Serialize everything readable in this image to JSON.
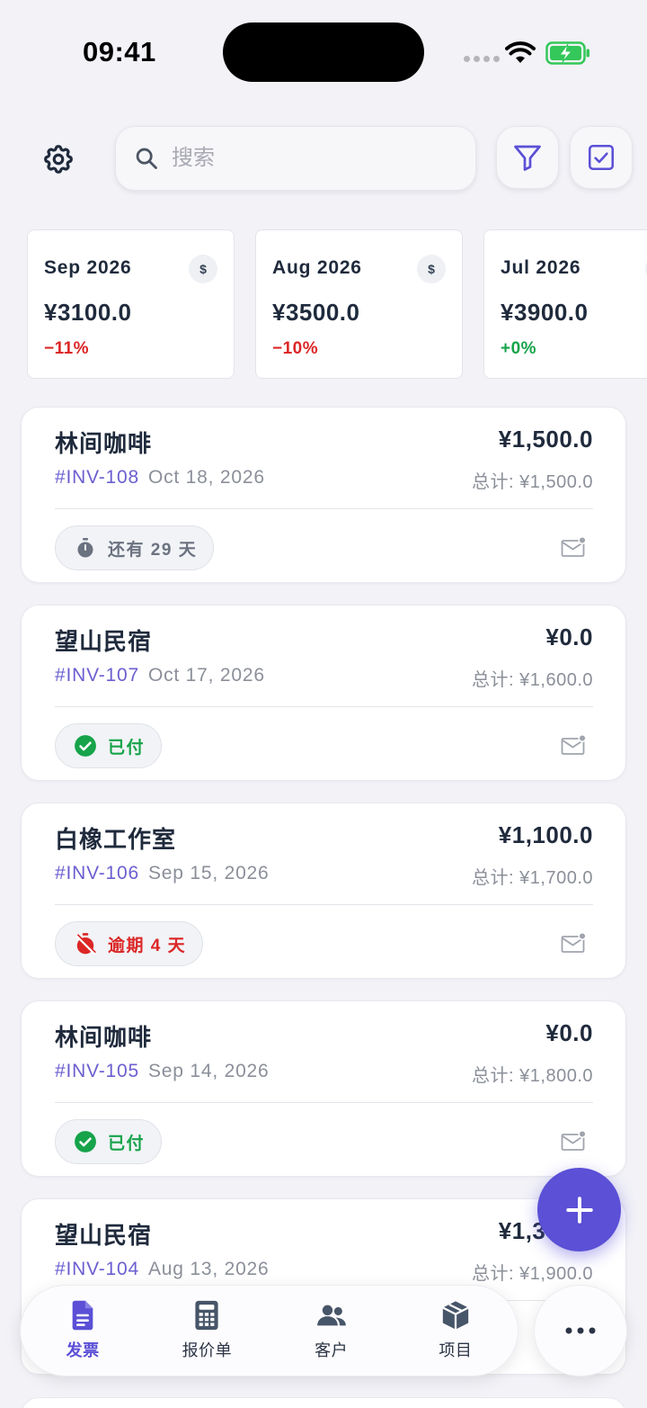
{
  "status_bar": {
    "time": "09:41"
  },
  "toolbar": {
    "settings_icon": "gear-icon",
    "search_placeholder": "搜索",
    "filter_icon": "funnel-icon",
    "select_icon": "checkbox-icon"
  },
  "summaries": [
    {
      "month": "Sep 2026",
      "amount": "¥3100.0",
      "change": "−11%",
      "trend": "negative"
    },
    {
      "month": "Aug 2026",
      "amount": "¥3500.0",
      "change": "−10%",
      "trend": "negative"
    },
    {
      "month": "Jul 2026",
      "amount": "¥3900.0",
      "change": "+0%",
      "trend": "positive"
    }
  ],
  "summary_badge": "$",
  "invoices": [
    {
      "client": "林间咖啡",
      "amount": "¥1,500.0",
      "number": "#INV-108",
      "date": "Oct 18, 2026",
      "total": "总计: ¥1,500.0",
      "status": "还有 29 天",
      "status_type": "due"
    },
    {
      "client": "望山民宿",
      "amount": "¥0.0",
      "number": "#INV-107",
      "date": "Oct 17, 2026",
      "total": "总计: ¥1,600.0",
      "status": "已付",
      "status_type": "paid"
    },
    {
      "client": "白橡工作室",
      "amount": "¥1,100.0",
      "number": "#INV-106",
      "date": "Sep 15, 2026",
      "total": "总计: ¥1,700.0",
      "status": "逾期 4 天",
      "status_type": "overdue"
    },
    {
      "client": "林间咖啡",
      "amount": "¥0.0",
      "number": "#INV-105",
      "date": "Sep 14, 2026",
      "total": "总计: ¥1,800.0",
      "status": "已付",
      "status_type": "paid"
    },
    {
      "client": "望山民宿",
      "amount": "¥1,300.0",
      "number": "#INV-104",
      "date": "Aug 13, 2026",
      "total": "总计: ¥1,900.0",
      "status": "",
      "status_type": "hidden"
    }
  ],
  "fab": {
    "icon": "plus-icon"
  },
  "tabs": [
    {
      "label": "发票",
      "icon": "document-icon",
      "active": true
    },
    {
      "label": "报价单",
      "icon": "calculator-icon",
      "active": false
    },
    {
      "label": "客户",
      "icon": "users-icon",
      "active": false
    },
    {
      "label": "项目",
      "icon": "box-icon",
      "active": false
    }
  ],
  "more": {
    "icon": "ellipsis-icon"
  },
  "colors": {
    "accent": "#5b50d6",
    "negative": "#dc2626",
    "positive": "#16a34a",
    "background": "#f2f2f7"
  }
}
